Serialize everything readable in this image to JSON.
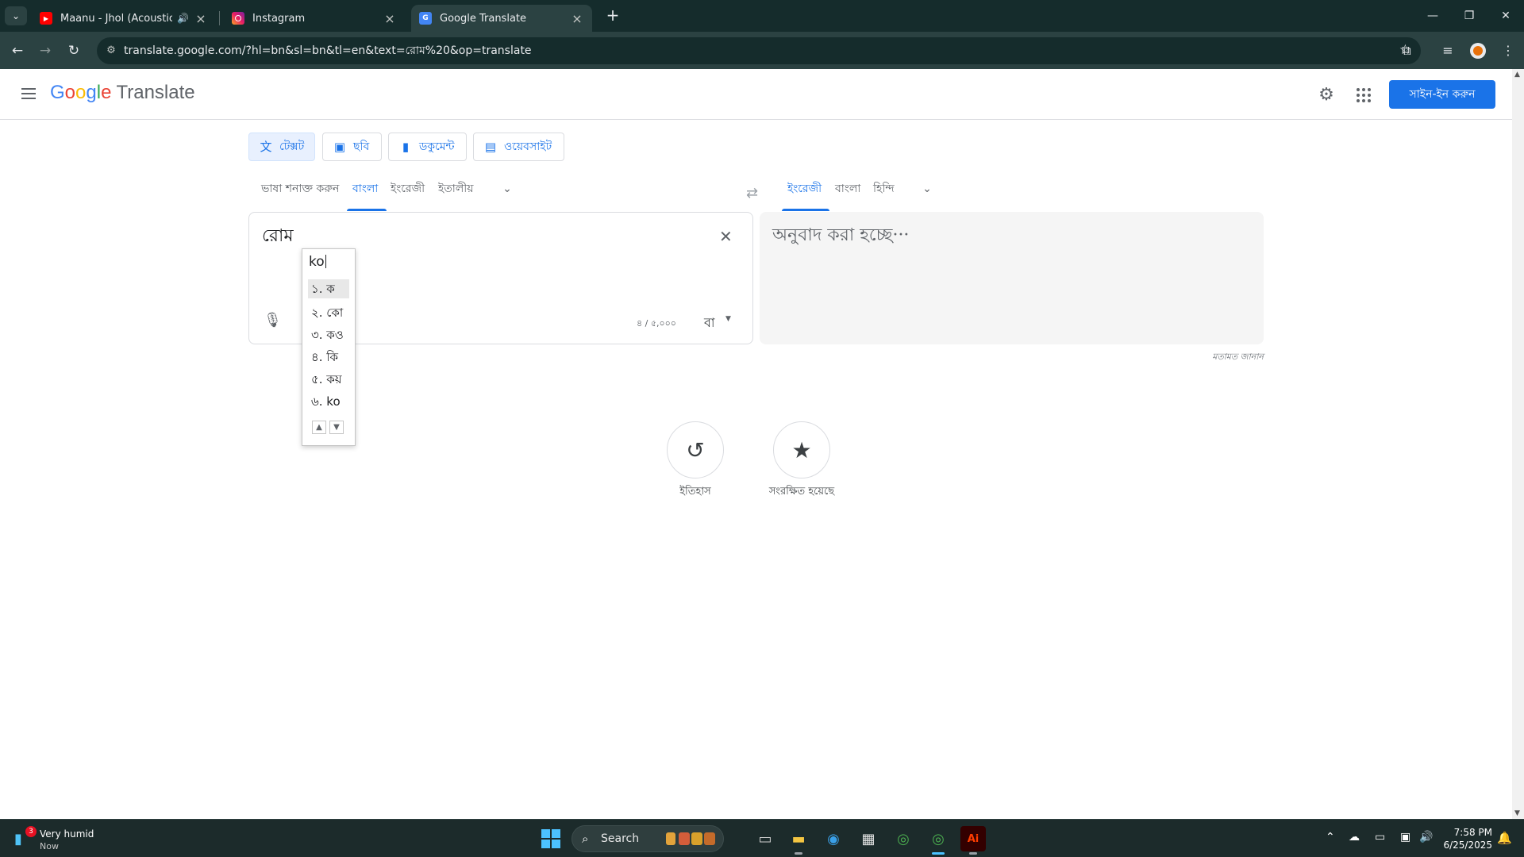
{
  "browser": {
    "tabs": [
      {
        "title": "Maanu - Jhol (Acoustic) | Ar",
        "favicon": "youtube-icon",
        "audio": true,
        "active": false
      },
      {
        "title": "Instagram",
        "favicon": "instagram-icon",
        "audio": false,
        "active": false
      },
      {
        "title": "Google Translate",
        "favicon": "translate-icon",
        "audio": false,
        "active": true
      }
    ],
    "url": "translate.google.com/?hl=bn&sl=bn&tl=en&text=রোম%20&op=translate"
  },
  "header": {
    "logo_letters": [
      "G",
      "o",
      "o",
      "g",
      "l",
      "e"
    ],
    "logo_product": "Translate",
    "signin_label": "সাইন-ইন করুন"
  },
  "modes": [
    {
      "label": "টেক্সট",
      "icon": "translate-icon",
      "active": true
    },
    {
      "label": "ছবি",
      "icon": "image-icon",
      "active": false
    },
    {
      "label": "ডকুমেন্ট",
      "icon": "document-icon",
      "active": false
    },
    {
      "label": "ওয়েবসাইট",
      "icon": "website-icon",
      "active": false
    }
  ],
  "source_langs": [
    "ভাষা শনাক্ত করুন",
    "বাংলা",
    "ইংরেজী",
    "ইতালীয়"
  ],
  "source_selected": "বাংলা",
  "target_langs": [
    "ইংরেজী",
    "বাংলা",
    "হিন্দি"
  ],
  "target_selected": "ইংরেজী",
  "source": {
    "text": "রোম",
    "char_count": "৪ / ৫,০০০",
    "ime_label": "বা"
  },
  "target": {
    "text": "অনুবাদ করা হচ্ছে···"
  },
  "feedback_label": "মতামত জানান",
  "ime": {
    "input": "ko",
    "candidates": [
      "১. ক",
      "২. কো",
      "৩. কও",
      "৪. কি",
      "৫. কয়",
      "৬. ko"
    ],
    "highlighted": 0
  },
  "history_label": "ইতিহাস",
  "saved_label": "সংরক্ষিত হয়েছে",
  "taskbar": {
    "weather_title": "Very humid",
    "weather_sub": "Now",
    "weather_badge": "3",
    "search_label": "Search",
    "time": "7:58 PM",
    "date": "6/25/2025"
  },
  "colors": {
    "accent": "#1a73e8",
    "chrome_dark": "#152c2c",
    "chrome_toolbar": "#2b4242"
  }
}
